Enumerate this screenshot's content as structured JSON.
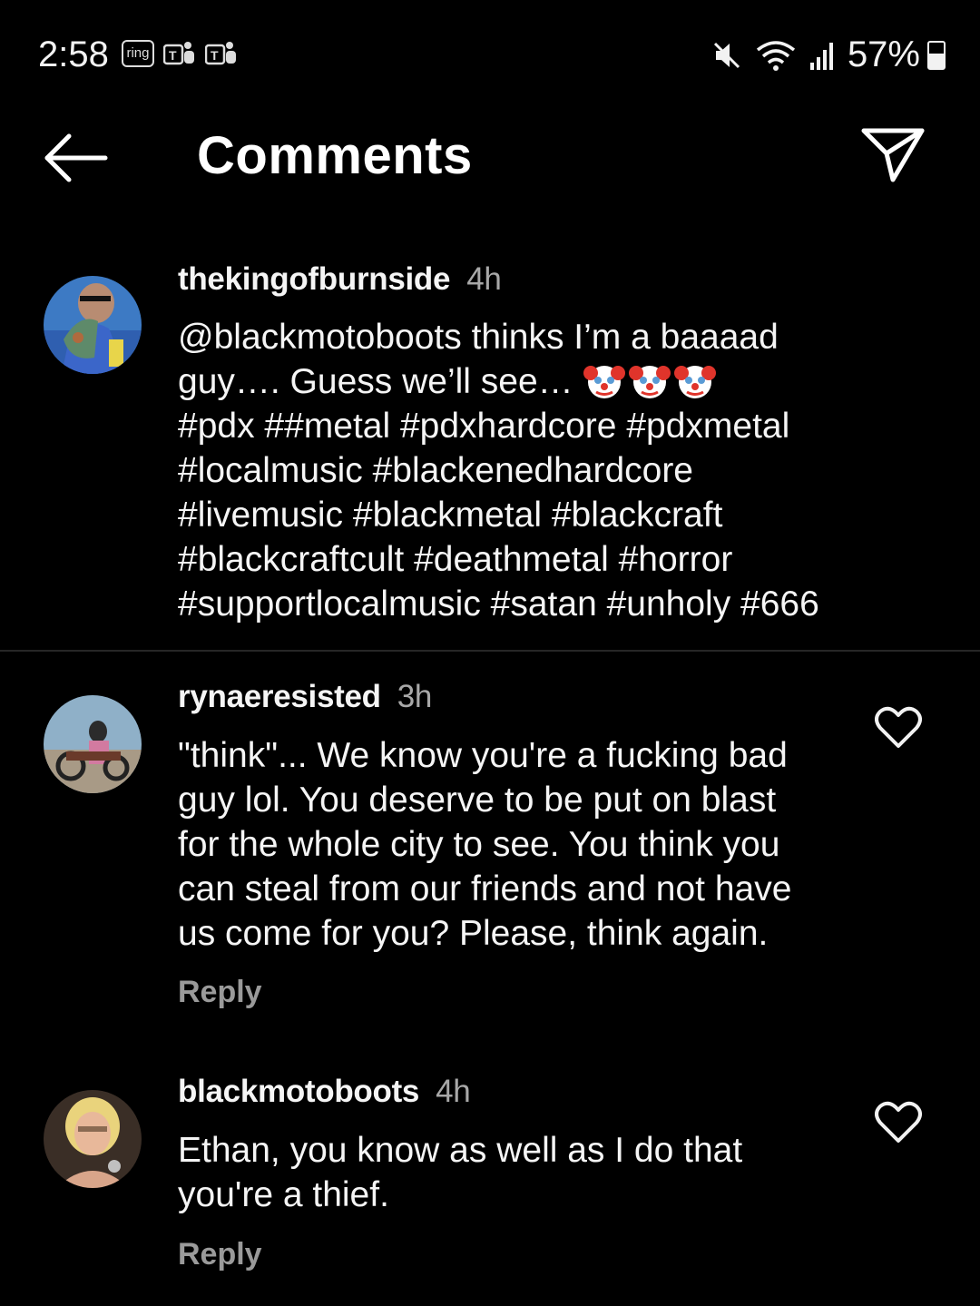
{
  "status_bar": {
    "time": "2:58",
    "ring_label": "ring",
    "battery": "57%",
    "battery_level": 0.57,
    "icons": [
      "ring-app-icon",
      "teams-icon",
      "teams-icon",
      "mute-icon",
      "wifi-icon",
      "signal-icon",
      "battery-icon"
    ]
  },
  "header": {
    "title": "Comments",
    "back_icon": "arrow-left-icon",
    "send_icon": "send-icon"
  },
  "comments": [
    {
      "username": "thekingofburnside",
      "time": "4h",
      "text_before_emoji": "@blackmotoboots thinks I’m a baaaad\nguy…. Guess we’ll see… ",
      "emoji": "🤡🤡🤡",
      "text_after_emoji": "\n#pdx ##metal #pdxhardcore #pdxmetal\n#localmusic  #blackenedhardcore\n#livemusic #blackmetal #blackcraft\n#blackcraftcult  #deathmetal  #horror\n#supportlocalmusic #satan #unholy #666"
    },
    {
      "username": "rynaeresisted",
      "time": "3h",
      "text": "\"think\"... We know you're a fucking bad\nguy lol. You deserve to be put on blast\nfor the whole city to see. You think you\ncan steal from our friends and not have\nus come for you? Please, think again.",
      "reply_label": "Reply"
    },
    {
      "username": "blackmotoboots",
      "time": "4h",
      "text": "Ethan, you know as well as I do that\nyou're a thief.",
      "reply_label": "Reply"
    }
  ],
  "colors": {
    "background": "#000000",
    "text": "#f5f5f5",
    "muted": "#a8a8a8",
    "divider": "#262626"
  }
}
